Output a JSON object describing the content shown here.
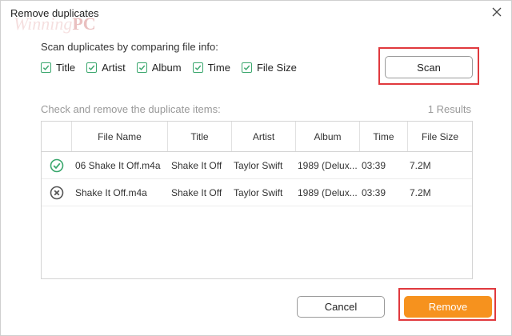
{
  "window": {
    "title": "Remove duplicates"
  },
  "watermark": {
    "script": "Winning",
    "mark": "PC"
  },
  "compare": {
    "instruction": "Scan duplicates by comparing file info:",
    "options": [
      {
        "label": "Title",
        "checked": true
      },
      {
        "label": "Artist",
        "checked": true
      },
      {
        "label": "Album",
        "checked": true
      },
      {
        "label": "Time",
        "checked": true
      },
      {
        "label": "File Size",
        "checked": true
      }
    ],
    "scan_label": "Scan"
  },
  "results": {
    "heading": "Check and remove the duplicate items:",
    "count_text": "1 Results",
    "columns": [
      "File Name",
      "Title",
      "Artist",
      "Album",
      "Time",
      "File Size"
    ],
    "rows": [
      {
        "status": "keep-check-icon",
        "file_name": "06 Shake It Off.m4a",
        "title": "Shake It Off",
        "artist": "Taylor Swift",
        "album": "1989 (Delux...",
        "time": "03:39",
        "size": "7.2M"
      },
      {
        "status": "remove-x-icon",
        "file_name": "Shake It Off.m4a",
        "title": "Shake It Off",
        "artist": "Taylor Swift",
        "album": "1989 (Delux...",
        "time": "03:39",
        "size": "7.2M"
      }
    ]
  },
  "footer": {
    "cancel_label": "Cancel",
    "remove_label": "Remove"
  },
  "colors": {
    "accent_orange": "#f6921e",
    "check_green": "#3aa76d",
    "highlight_red": "#e0393e"
  }
}
